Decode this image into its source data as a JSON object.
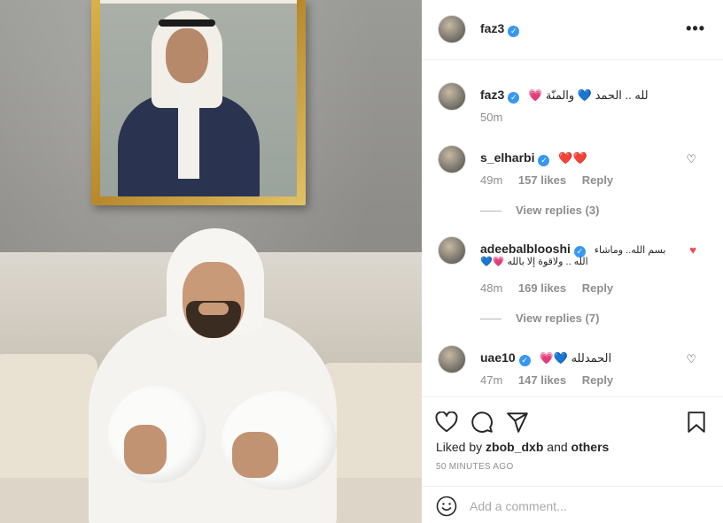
{
  "post": {
    "author": "faz3",
    "more_label": "•••"
  },
  "caption": {
    "username": "faz3",
    "text": "لله .. الحمد 💙 والمنّة 💗",
    "time": "50m"
  },
  "comments": [
    {
      "username": "s_elharbi",
      "text": "❤️❤️",
      "time": "49m",
      "likes": "157 likes",
      "reply": "Reply",
      "view_replies": "View replies (3)",
      "liked": false
    },
    {
      "username": "adeebalblooshi",
      "text_line1": "بسم الله.. وماشاء",
      "text_line2": "الله .. ولاقوة إلا بالله 💗💙",
      "time": "48m",
      "likes": "169 likes",
      "reply": "Reply",
      "view_replies": "View replies (7)",
      "liked": true
    },
    {
      "username": "uae10",
      "text": "الحمدلله 💙💗",
      "time": "47m",
      "likes": "147 likes",
      "reply": "Reply",
      "liked": false
    }
  ],
  "actions": {
    "icons": [
      "heart-icon",
      "comment-icon",
      "share-icon",
      "bookmark-icon"
    ]
  },
  "likes_summary": {
    "prefix": "Liked by",
    "user": "zbob_dxb",
    "connector": "and",
    "suffix": "others"
  },
  "timestamp": "50 MINUTES AGO",
  "add_comment": {
    "placeholder": "Add a comment..."
  },
  "colors": {
    "verified": "#3897f0",
    "like_red": "#ed4956",
    "meta_gray": "#8e8e8e"
  }
}
